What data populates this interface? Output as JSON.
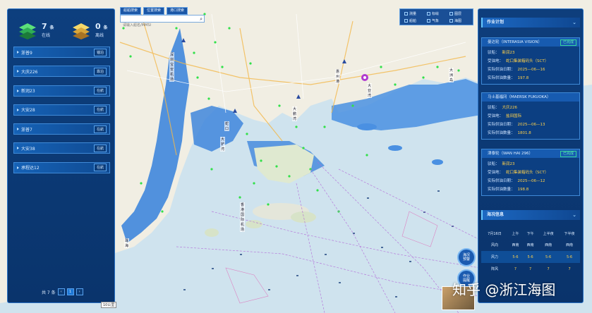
{
  "summary": {
    "online_count": "7",
    "online_unit": "条",
    "online_label": "在线",
    "offline_count": "0",
    "offline_unit": "条",
    "offline_label": "离线"
  },
  "vessels": [
    {
      "name": "浙普9",
      "status": "锚泊"
    },
    {
      "name": "大庆226",
      "status": "靠泊"
    },
    {
      "name": "新润23",
      "status": "在航"
    },
    {
      "name": "大安28",
      "status": "在航"
    },
    {
      "name": "浙普7",
      "status": "在航"
    },
    {
      "name": "大安38",
      "status": "在航"
    },
    {
      "name": "承程达12",
      "status": "在航"
    }
  ],
  "pagination": {
    "total": "共 7 条",
    "prev": "‹",
    "page": "1",
    "next": "›"
  },
  "top_tabs": [
    "船舶搜索",
    "位置搜索",
    "港口搜索"
  ],
  "search": {
    "placeholder": "请输入船名/MMSI"
  },
  "tools": {
    "t1": "测量",
    "t2": "标绘",
    "t3": "图层",
    "t4": "船舶",
    "t5": "气象",
    "t6": "海图"
  },
  "work_plan": {
    "title": "作业计划",
    "labels": {
      "ship": "驳船：",
      "receiver": "受油地：",
      "date": "实际供油日期：",
      "qty": "实际供油数量："
    },
    "items": [
      {
        "vessel": "曼达轮（INTERASIA VISION）",
        "tag": "已完成",
        "barge": "新润23",
        "receiver": "蛇口集装箱码头（SCT）",
        "date": "2025—06—16",
        "qty": "197.8"
      },
      {
        "vessel": "马士基福冈（MAERSK FUKUOKA）",
        "tag": "",
        "barge": "大庆226",
        "receiver": "盐田国际",
        "date": "2025—06—13",
        "qty": "1801.8"
      },
      {
        "vessel": "津泰轮（WAN HAI 296）",
        "tag": "已完成",
        "barge": "新润23",
        "receiver": "蛇口集装箱码头（SCT）",
        "date": "2025—06—12",
        "qty": "198.8"
      }
    ]
  },
  "tide": {
    "title": "海况信息",
    "header": [
      "7月16日",
      "上午",
      "下午",
      "上半夜",
      "下半夜"
    ],
    "rows": [
      [
        "风向",
        "西南",
        "西南",
        "西南",
        "西南"
      ],
      [
        "风力",
        "5-6",
        "5-6",
        "5-6",
        "5-6"
      ],
      [
        "阵风",
        "7",
        "7",
        "7",
        "7"
      ]
    ]
  },
  "map_labels": {
    "a": "深圳宝安机场",
    "b": "大铲湾",
    "c": "蛇口",
    "d": "大鹏湾",
    "e": "香港国际机场",
    "f": "大亚湾",
    "g": "惠州港",
    "h": "大洲岛",
    "i": "珠海"
  },
  "bubbles": {
    "b1": "海况\n预警",
    "b2": "作业\n提醒"
  },
  "scale": "10公里",
  "watermark": "知乎 @浙江海图",
  "colors": {
    "panel": "#0d3f7e",
    "accent": "#3f8ad8",
    "sea": "#4b8ee0",
    "land": "#f2efe6"
  }
}
